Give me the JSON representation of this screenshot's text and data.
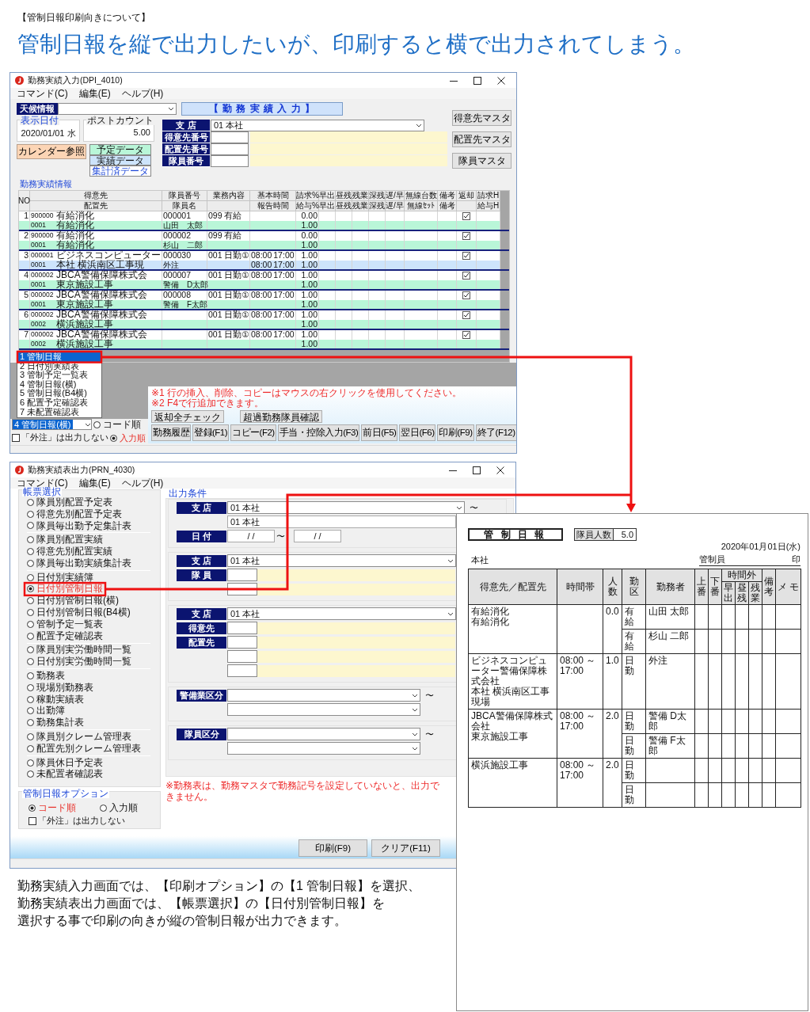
{
  "page_heading": "【管制日報印刷向きについて】",
  "headline": "管制日報を縦で出力したいが、印刷すると横で出力されてしまう。",
  "entry_window": {
    "title": "勤務実績入力(DPI_4010)",
    "menu": [
      "コマンド(C)",
      "編集(E)",
      "ヘルプ(H)"
    ],
    "weather_label": "天候情報",
    "banner": "【 勤 務 実 績 入 力 】",
    "date_group": {
      "title": "表示日付",
      "value": "2020/01/01 水"
    },
    "post_count": {
      "title": "ポストカウント",
      "value": "5.00"
    },
    "calendar_button": "カレンダー参照",
    "legend": [
      {
        "label": "予定データ",
        "kind": "planned"
      },
      {
        "label": "実績データ",
        "kind": "actual"
      },
      {
        "label": "集計済データ",
        "kind": "totaled"
      }
    ],
    "fields": [
      {
        "label": "支 店",
        "kind": "combo",
        "value": "01 本社"
      },
      {
        "label": "得意先番号",
        "kind": "lookup"
      },
      {
        "label": "配置先番号",
        "kind": "lookup"
      },
      {
        "label": "隊員番号",
        "kind": "lookup"
      }
    ],
    "side_buttons": [
      "得意先マスタ",
      "配置先マスタ",
      "隊員マスタ"
    ],
    "section_title": "勤務実績情報",
    "columns": [
      {
        "top": "NO"
      },
      {
        "top": "得意先",
        "bottom": "配置先"
      },
      {
        "top": "隊員番号",
        "bottom": "隊員名"
      },
      {
        "top": "業務内容"
      },
      {
        "top": "基本時間",
        "bottom": "報告時間"
      },
      {
        "top": "請求%",
        "bottom": "給与%"
      },
      {
        "top": "早出",
        "bottom": "早出"
      },
      {
        "top": "昼残",
        "bottom": "昼残"
      },
      {
        "top": "残業",
        "bottom": "残業"
      },
      {
        "top": "深残",
        "bottom": "深残"
      },
      {
        "top": "遅/早",
        "bottom": "遅/早"
      },
      {
        "top": "無線台数",
        "bottom": "無線ｾｯﾄ"
      },
      {
        "top": "備考",
        "bottom": "備考"
      },
      {
        "top": "返却"
      },
      {
        "top": "請求H",
        "bottom": "給与H"
      }
    ],
    "rows": [
      {
        "no": "1",
        "customer_code": "900000",
        "customer": "有給消化",
        "staff_no": "000001",
        "work": "099 有給",
        "pct": "0.00",
        "returned": true,
        "site_code": "0001",
        "site": "有給消化",
        "staff_name": "山田　太郎",
        "pay_pct": "1.00",
        "color": "#b9f6d8"
      },
      {
        "no": "2",
        "customer_code": "900000",
        "customer": "有給消化",
        "staff_no": "000002",
        "work": "099 有給",
        "pct": "0.00",
        "returned": true,
        "site_code": "0001",
        "site": "有給消化",
        "staff_name": "杉山　二郎",
        "pay_pct": "1.00",
        "color": "#b9f6d8"
      },
      {
        "no": "3",
        "customer_code": "000001",
        "customer": "ビジネスコンピューター",
        "staff_no": "000030",
        "work": "001 日勤①",
        "start": "08:00",
        "end": "17:00",
        "pct": "1.00",
        "returned": true,
        "site_code": "0001",
        "site": "本社 横浜南区工事現",
        "staff_name": "外注",
        "report_start": "08:00",
        "report_end": "17:00",
        "pay_pct": "1.00",
        "color": "#cde4fb"
      },
      {
        "no": "4",
        "customer_code": "000002",
        "customer": "JBCA警備保障株式会",
        "staff_no": "000007",
        "work": "001 日勤①",
        "start": "08:00",
        "end": "17:00",
        "pct": "1.00",
        "returned": true,
        "site_code": "0001",
        "site": "東京施設工事",
        "staff_name": "警備　D太郎",
        "pay_pct": "1.00",
        "color": "#b9f6d8"
      },
      {
        "no": "5",
        "customer_code": "000002",
        "customer": "JBCA警備保障株式会",
        "staff_no": "000008",
        "work": "001 日勤①",
        "start": "08:00",
        "end": "17:00",
        "pct": "1.00",
        "returned": true,
        "site_code": "0001",
        "site": "東京施設工事",
        "staff_name": "警備　F太郎",
        "pay_pct": "1.00",
        "color": "#b9f6d8"
      },
      {
        "no": "6",
        "customer_code": "000002",
        "customer": "JBCA警備保障株式会",
        "work": "001 日勤①",
        "start": "08:00",
        "end": "17:00",
        "pct": "1.00",
        "returned": true,
        "site_code": "0002",
        "site": "横浜施設工事",
        "pay_pct": "1.00",
        "color": "#b9f6d8"
      },
      {
        "no": "7",
        "customer_code": "000002",
        "customer": "JBCA警備保障株式会",
        "work": "001 日勤①",
        "start": "08:00",
        "end": "17:00",
        "pct": "1.00",
        "returned": true,
        "site_code": "0002",
        "site": "横浜施設工事",
        "pay_pct": "1.00",
        "color": "#b9f6d8"
      }
    ],
    "print_options": [
      {
        "label": "1 管制日報",
        "selected": true
      },
      {
        "label": "2 日付別実績表",
        "selected": false
      },
      {
        "label": "3 管制予定一覧表",
        "selected": false
      },
      {
        "label": "4 管制日報(横)",
        "selected": false
      },
      {
        "label": "5 管制日報(B4横)",
        "selected": false
      },
      {
        "label": "6 配置予定確認表",
        "selected": false
      },
      {
        "label": "7 未配置確認表",
        "selected": false
      }
    ],
    "print_option_value": "4 管制日報(横)",
    "order": [
      {
        "label": "コード順",
        "selected": false
      },
      {
        "label": "入力順",
        "selected": true
      }
    ],
    "exclude_outsourced": {
      "label": "「外注」は出力しない",
      "checked": false
    },
    "small_buttons": [
      "返却全チェック",
      "超過勤務隊員確認"
    ],
    "notes": [
      "※1 行の挿入、削除、コピーはマウスの右クリックを使用してください。",
      "※2 F4で行追加できます。"
    ],
    "function_buttons": [
      "勤務履歴",
      "登録(F1)",
      "コピー(F2)",
      "手当・控除入力(F3)",
      "前日(F5)",
      "翌日(F6)",
      "印刷(F9)",
      "終了(F12)"
    ]
  },
  "output_window": {
    "title": "勤務実績表出力(PRN_4030)",
    "menu": [
      "コマンド(C)",
      "編集(E)",
      "ヘルプ(H)"
    ],
    "report_title": "帳票選択",
    "report_groups": [
      [
        {
          "label": "隊員別配置予定表",
          "selected": false
        },
        {
          "label": "得意先別配置予定表",
          "selected": false
        },
        {
          "label": "隊員毎出勤予定集計表",
          "selected": false
        }
      ],
      [
        {
          "label": "隊員別配置実績",
          "selected": false
        },
        {
          "label": "得意先別配置実績",
          "selected": false
        },
        {
          "label": "隊員毎出勤実績集計表",
          "selected": false
        }
      ],
      [
        {
          "label": "日付別実績簿",
          "selected": false
        },
        {
          "label": "日付別管制日報",
          "selected": true
        },
        {
          "label": "日付別管制日報(横)",
          "selected": false
        },
        {
          "label": "日付別管制日報(B4横)",
          "selected": false
        },
        {
          "label": "管制予定一覧表",
          "selected": false
        },
        {
          "label": "配置予定確認表",
          "selected": false
        }
      ],
      [
        {
          "label": "隊員別実労働時間一覧",
          "selected": false
        },
        {
          "label": "日付別実労働時間一覧",
          "selected": false
        }
      ],
      [
        {
          "label": "勤務表",
          "selected": false
        },
        {
          "label": "現場別勤務表",
          "selected": false
        },
        {
          "label": "稼動実績表",
          "selected": false
        },
        {
          "label": "出勤簿",
          "selected": false
        },
        {
          "label": "勤務集計表",
          "selected": false
        }
      ],
      [
        {
          "label": "隊員別クレーム管理表",
          "selected": false
        },
        {
          "label": "配置先別クレーム管理表",
          "selected": false
        }
      ],
      [
        {
          "label": "隊員休日予定表",
          "selected": false
        },
        {
          "label": "未配置者確認表",
          "selected": false
        }
      ]
    ],
    "option_title": "管制日報オプション",
    "order": [
      {
        "label": "コード順",
        "selected": true
      },
      {
        "label": "入力順",
        "selected": false
      }
    ],
    "exclude_outsourced": {
      "label": "「外注」は出力しない",
      "checked": false
    },
    "conditions_title": "出力条件",
    "sections": [
      [
        {
          "kind": "combo",
          "label": "支 店",
          "value": "01 本社",
          "range": "〜"
        },
        {
          "kind": "text",
          "value": "01 本社"
        },
        {
          "kind": "dates",
          "label": "日 付",
          "from": "/ /",
          "to": "/ /",
          "range": "〜"
        }
      ],
      [
        {
          "kind": "combo",
          "label": "支 店",
          "value": "01 本社"
        },
        {
          "kind": "lookup",
          "label": "隊 員"
        },
        {
          "kind": "lookup"
        }
      ],
      [
        {
          "kind": "combo",
          "label": "支 店",
          "value": "01 本社"
        },
        {
          "kind": "lookup",
          "label": "得意先"
        },
        {
          "kind": "lookup",
          "label": "配置先"
        },
        {
          "kind": "lookup"
        },
        {
          "kind": "lookup"
        }
      ],
      [
        {
          "kind": "combo",
          "label": "警備業区分",
          "range": "〜"
        },
        {
          "kind": "combo"
        }
      ],
      [
        {
          "kind": "combo",
          "label": "隊員区分",
          "range": "〜"
        },
        {
          "kind": "combo"
        }
      ]
    ],
    "note": "※勤務表は、勤務マスタで勤務記号を設定していないと、出力できません。",
    "buttons": [
      "印刷(F9)",
      "クリア(F11)"
    ]
  },
  "print_preview": {
    "title": "管 制 日 報",
    "count_label": "隊員人数",
    "count": "5.0",
    "date": "2020年01月01日(水)",
    "branch": "本社",
    "controller_label": "管制員",
    "seal": "印",
    "columns": [
      {
        "label": "得意先／配置先",
        "kind": "wide"
      },
      {
        "label": "時間帯",
        "kind": "wide"
      },
      {
        "label": "人数",
        "kind": "narrow"
      },
      {
        "label": "勤区",
        "kind": "narrow"
      },
      {
        "label": "勤務者",
        "kind": "wide"
      },
      {
        "label": "上番",
        "kind": "narrow"
      },
      {
        "label": "下番",
        "kind": "narrow"
      },
      {
        "label": "時間外",
        "kind": "group",
        "sub": [
          "早出",
          "昼残",
          "残業"
        ]
      },
      {
        "label": "備考",
        "kind": "narrow"
      },
      {
        "label": "メ モ",
        "kind": "wide"
      }
    ],
    "groups": [
      {
        "customer": "有給消化",
        "site": "有給消化",
        "count": "0.0",
        "staff": [
          {
            "type": "有給",
            "name": "山田 太郎"
          },
          {
            "type": "有給",
            "name": "杉山 二郎"
          }
        ]
      },
      {
        "customer": "ビジネスコンピューター警備保障株式会社",
        "site": "本社 横浜南区工事現場",
        "time": "08:00 ～ 17:00",
        "count": "1.0",
        "staff": [
          {
            "type": "日勤",
            "name": "外注"
          }
        ]
      },
      {
        "customer": "JBCA警備保障株式会社",
        "site": "東京施設工事",
        "time": "08:00 ～ 17:00",
        "count": "2.0",
        "staff": [
          {
            "type": "日勤",
            "name": "警備 D太郎"
          },
          {
            "type": "日勤",
            "name": "警備 F太郎"
          }
        ]
      },
      {
        "site": "横浜施設工事",
        "time": "08:00 ～ 17:00",
        "count": "2.0",
        "staff": [
          {
            "type": "日勤"
          },
          {
            "type": "日勤"
          }
        ]
      }
    ]
  },
  "summary": [
    "勤務実績入力画面では、【印刷オプション】の【1 管制日報】を選択、",
    "勤務実績表出力画面では、【帳票選択】の【日付別管制日報】を",
    "選択する事で印刷の向きが縦の管制日報が出力できます。"
  ]
}
